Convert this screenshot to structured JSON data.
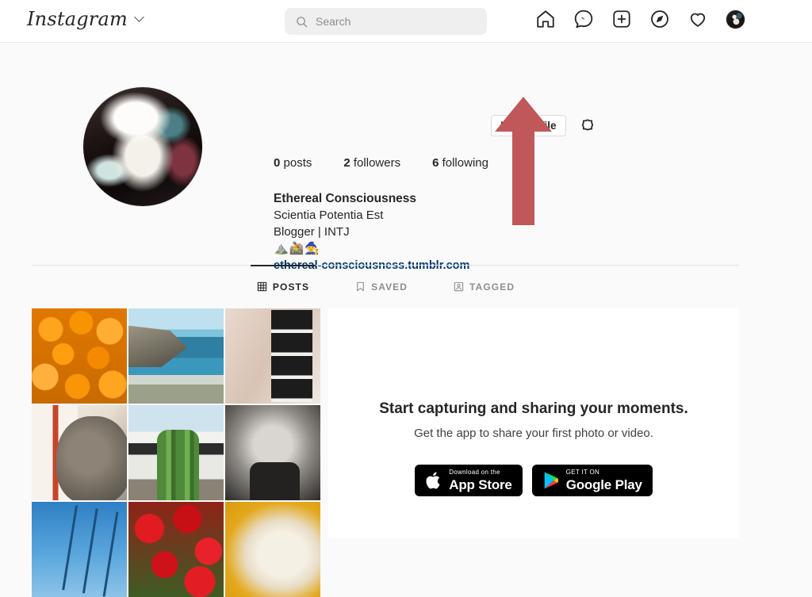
{
  "nav": {
    "logo": "Instagram",
    "logo_chevron_icon": "chevron-down-icon",
    "search_placeholder": "Search",
    "search_value": "",
    "search_icon": "search-icon",
    "icons": [
      {
        "name": "home-icon",
        "label": "Home"
      },
      {
        "name": "messenger-icon",
        "label": "Messenger"
      },
      {
        "name": "new-post-icon",
        "label": "New post"
      },
      {
        "name": "explore-compass-icon",
        "label": "Explore"
      },
      {
        "name": "activity-heart-icon",
        "label": "Activity"
      },
      {
        "name": "profile-avatar",
        "label": "Profile"
      }
    ]
  },
  "profile": {
    "edit_button_label": "Edit profile",
    "settings_icon": "settings-gear-icon",
    "stats": [
      {
        "count": "0",
        "label": "posts"
      },
      {
        "count": "2",
        "label": "followers"
      },
      {
        "count": "6",
        "label": "following"
      }
    ],
    "full_name": "Ethereal Consciousness",
    "bio_line_1": "Scientia Potentia Est",
    "bio_line_2": "Blogger | INTJ",
    "bio_emoji": "⛰️🚵🧙",
    "website": "ethereal-consciousness.tumblr.com"
  },
  "tabs": [
    {
      "label": "POSTS",
      "icon": "grid-icon",
      "active": true
    },
    {
      "label": "SAVED",
      "icon": "bookmark-icon",
      "active": false
    },
    {
      "label": "TAGGED",
      "icon": "tagged-person-icon",
      "active": false
    }
  ],
  "grid": {
    "thumbnails": [
      {
        "name": "thumbnail-oranges",
        "alt": "oranges"
      },
      {
        "name": "thumbnail-coastline",
        "alt": "coastline"
      },
      {
        "name": "thumbnail-photobooth-strip",
        "alt": "photobooth strip"
      },
      {
        "name": "thumbnail-dog-on-blanket",
        "alt": "dog on blanket"
      },
      {
        "name": "thumbnail-cactus-house",
        "alt": "cactus and house"
      },
      {
        "name": "thumbnail-baby-smiling",
        "alt": "smiling baby"
      },
      {
        "name": "thumbnail-sky-cables",
        "alt": "blue sky with cables"
      },
      {
        "name": "thumbnail-red-flowers",
        "alt": "red flowers"
      },
      {
        "name": "thumbnail-white-dog",
        "alt": "white dog on yellow"
      }
    ]
  },
  "empty_state": {
    "title": "Start capturing and sharing your moments.",
    "subtitle": "Get the app to share your first photo or video.",
    "badges": [
      {
        "name": "app-store-badge",
        "icon": "apple-icon",
        "small": "Download on the",
        "big": "App Store"
      },
      {
        "name": "google-play-badge",
        "icon": "google-play-icon",
        "small": "GET IT ON",
        "big": "Google Play"
      }
    ]
  },
  "annotation": {
    "arrow_icon": "annotation-arrow-up-icon",
    "arrow_color": "#c0585a",
    "points_to": "Edit profile"
  },
  "colors": {
    "page_bg": "#fafafa",
    "panel_bg": "#ffffff",
    "text_primary": "#262626",
    "text_secondary": "#8e8e8e",
    "link": "#00376b",
    "border": "#dbdbdb"
  }
}
